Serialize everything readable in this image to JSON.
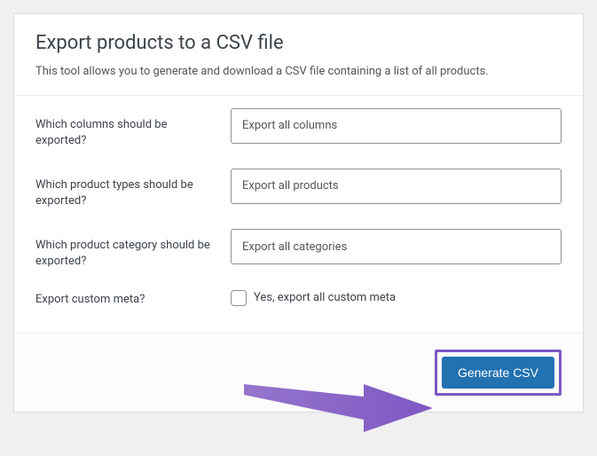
{
  "header": {
    "title": "Export products to a CSV file",
    "description": "This tool allows you to generate and download a CSV file containing a list of all products."
  },
  "form": {
    "columns": {
      "label": "Which columns should be exported?",
      "value": "Export all columns"
    },
    "types": {
      "label": "Which product types should be exported?",
      "value": "Export all products"
    },
    "category": {
      "label": "Which product category should be exported?",
      "value": "Export all categories"
    },
    "meta": {
      "label": "Export custom meta?",
      "checkbox_label": "Yes, export all custom meta"
    }
  },
  "footer": {
    "button": "Generate CSV"
  }
}
